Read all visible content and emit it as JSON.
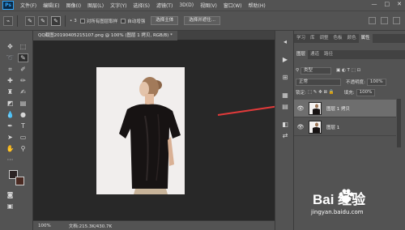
{
  "app": {
    "logo": "Ps",
    "menu": [
      "文件(F)",
      "编辑(E)",
      "图像(I)",
      "图层(L)",
      "文字(Y)",
      "选择(S)",
      "滤镜(T)",
      "3D(D)",
      "视图(V)",
      "窗口(W)",
      "帮助(H)"
    ],
    "window_controls": [
      "—",
      "□",
      "✕"
    ]
  },
  "options_bar": {
    "brush_size": "3",
    "sample_all_label": "对所有图层取样",
    "auto_enhance_label": "自动增强",
    "select_subject_label": "选择主体",
    "select_and_mask_label": "选择并遮住..."
  },
  "document": {
    "tab_title": "QQ截图20190405215107.png @ 100% (图层 1 拷贝, RGB/8) *",
    "zoom": "100%",
    "doc_info": "文档:215.3K/430.7K"
  },
  "panels": {
    "top_tabs": [
      "学习",
      "库",
      "调整",
      "色板",
      "颜色",
      "属性"
    ],
    "active_top_tab": "属性",
    "layer_tabs": [
      "图层",
      "通道",
      "路径"
    ],
    "filter_kind": "类型",
    "blend_mode": "正常",
    "opacity_label": "不透明度:",
    "opacity_value": "100%",
    "lock_label": "锁定:",
    "fill_label": "填充:",
    "fill_value": "100%",
    "layers": [
      {
        "name": "图层 1 拷贝",
        "selected": true,
        "visible": true
      },
      {
        "name": "图层 1",
        "selected": false,
        "visible": true
      }
    ]
  },
  "watermark": {
    "brand": "Bai 经验",
    "url": "jingyan.baidu.com"
  },
  "colors": {
    "foreground": "#2c2424",
    "background": "#4a2a22",
    "arrow": "#e23a3a"
  }
}
